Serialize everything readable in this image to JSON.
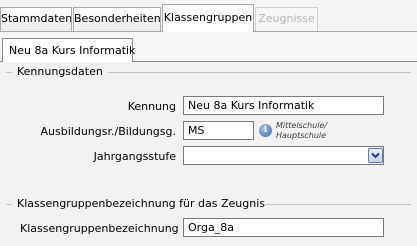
{
  "tabs": [
    {
      "label": "Stammdaten",
      "state": "normal"
    },
    {
      "label": "Besonderheiten",
      "state": "normal"
    },
    {
      "label": "Klassengruppen",
      "state": "active"
    },
    {
      "label": "Zeugnisse",
      "state": "disabled"
    }
  ],
  "subtab": {
    "label": "Neu 8a Kurs Informatik"
  },
  "kennungsdaten": {
    "title": "Kennungsdaten",
    "kennung": {
      "label": "Kennung",
      "value": "Neu 8a Kurs Informatik"
    },
    "ausbildung": {
      "label": "Ausbildungsr./Bildungsg.",
      "value": "MS",
      "hint_line1": "Mittelschule/",
      "hint_line2": "Hauptschule",
      "icon": "info-icon"
    },
    "jahrgangsstufe": {
      "label": "Jahrgangsstufe",
      "value": "",
      "icon": "chevron-down-icon"
    }
  },
  "zeugnis": {
    "title": "Klassengruppenbezeichnung für das Zeugnis",
    "bezeichnung": {
      "label": "Klassengruppenbezeichnung",
      "value": "Orga_8a"
    }
  },
  "colors": {
    "tab_border": "#a9a9a9",
    "disabled_text": "#b8b8b8",
    "info_blue": "#3a6fb2"
  }
}
